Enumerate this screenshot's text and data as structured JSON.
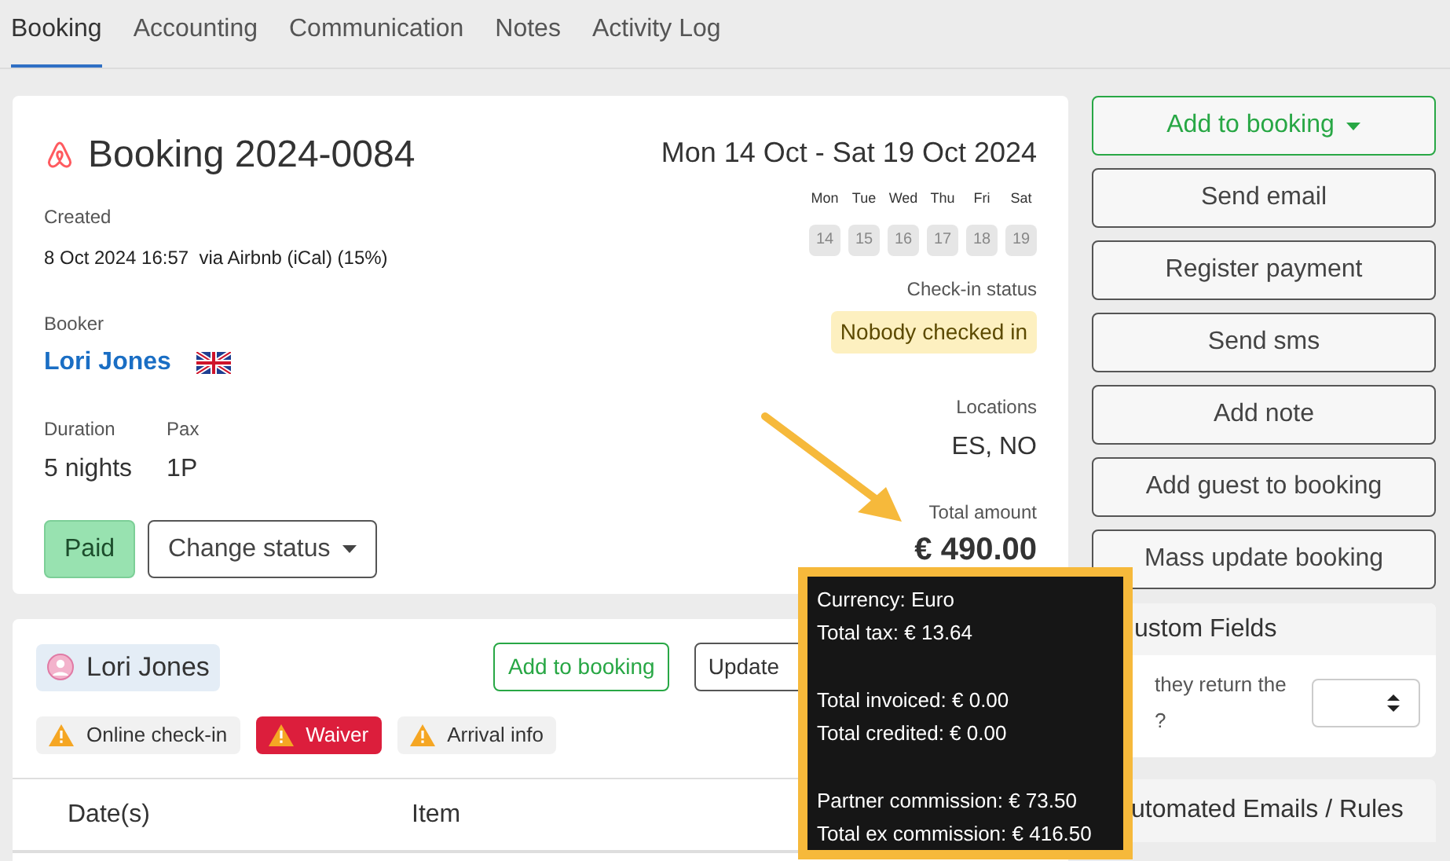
{
  "tabs": [
    {
      "label": "Booking",
      "selected": true
    },
    {
      "label": "Accounting",
      "selected": false
    },
    {
      "label": "Communication",
      "selected": false
    },
    {
      "label": "Notes",
      "selected": false
    },
    {
      "label": "Activity Log",
      "selected": false
    }
  ],
  "booking": {
    "title": "Booking 2024-0084",
    "date_range": "Mon 14 Oct - Sat 19 Oct 2024",
    "weekdays": [
      {
        "label": "Mon",
        "day": "14"
      },
      {
        "label": "Tue",
        "day": "15"
      },
      {
        "label": "Wed",
        "day": "16"
      },
      {
        "label": "Thu",
        "day": "17"
      },
      {
        "label": "Fri",
        "day": "18"
      },
      {
        "label": "Sat",
        "day": "19"
      }
    ],
    "created_label": "Created",
    "created_value": "8 Oct 2024 16:57  via Airbnb (iCal) (15%)",
    "booker_label": "Booker",
    "booker_name": "Lori Jones",
    "checkin_label": "Check-in status",
    "checkin_status": "Nobody checked in",
    "duration_label": "Duration",
    "duration": "5 nights",
    "pax_label": "Pax",
    "pax": "1P",
    "locations_label": "Locations",
    "locations": "ES, NO",
    "payment_status": "Paid",
    "change_status": "Change status",
    "total_label": "Total amount",
    "total": "€ 490.00"
  },
  "actions": [
    {
      "label": "Add to booking",
      "kind": "dropdown"
    },
    {
      "label": "Send email",
      "kind": "button"
    },
    {
      "label": "Register payment",
      "kind": "button"
    },
    {
      "label": "Send sms",
      "kind": "button"
    },
    {
      "label": "Add note",
      "kind": "button"
    },
    {
      "label": "Add guest to booking",
      "kind": "button"
    },
    {
      "label": "Mass update booking",
      "kind": "button"
    }
  ],
  "guest": {
    "name": "Lori Jones",
    "add_button": "Add to booking",
    "update_button": "Update",
    "badges": [
      {
        "label": "Online check-in",
        "kind": "warning"
      },
      {
        "label": "Waiver",
        "kind": "danger"
      },
      {
        "label": "Arrival info",
        "kind": "warning"
      }
    ],
    "columns": [
      "Date(s)",
      "Item"
    ]
  },
  "custom_fields": {
    "title": "ustom Fields",
    "question_lines": [
      "they return the",
      "?"
    ]
  },
  "automated": {
    "title": "utomated Emails / Rules"
  },
  "tooltip": {
    "groups": [
      [
        "Currency: Euro",
        "Total tax: € 13.64"
      ],
      [
        "Total invoiced: € 0.00",
        "Total credited: € 0.00"
      ],
      [
        "Partner commission: € 73.50",
        "Total ex commission: € 416.50"
      ]
    ]
  }
}
